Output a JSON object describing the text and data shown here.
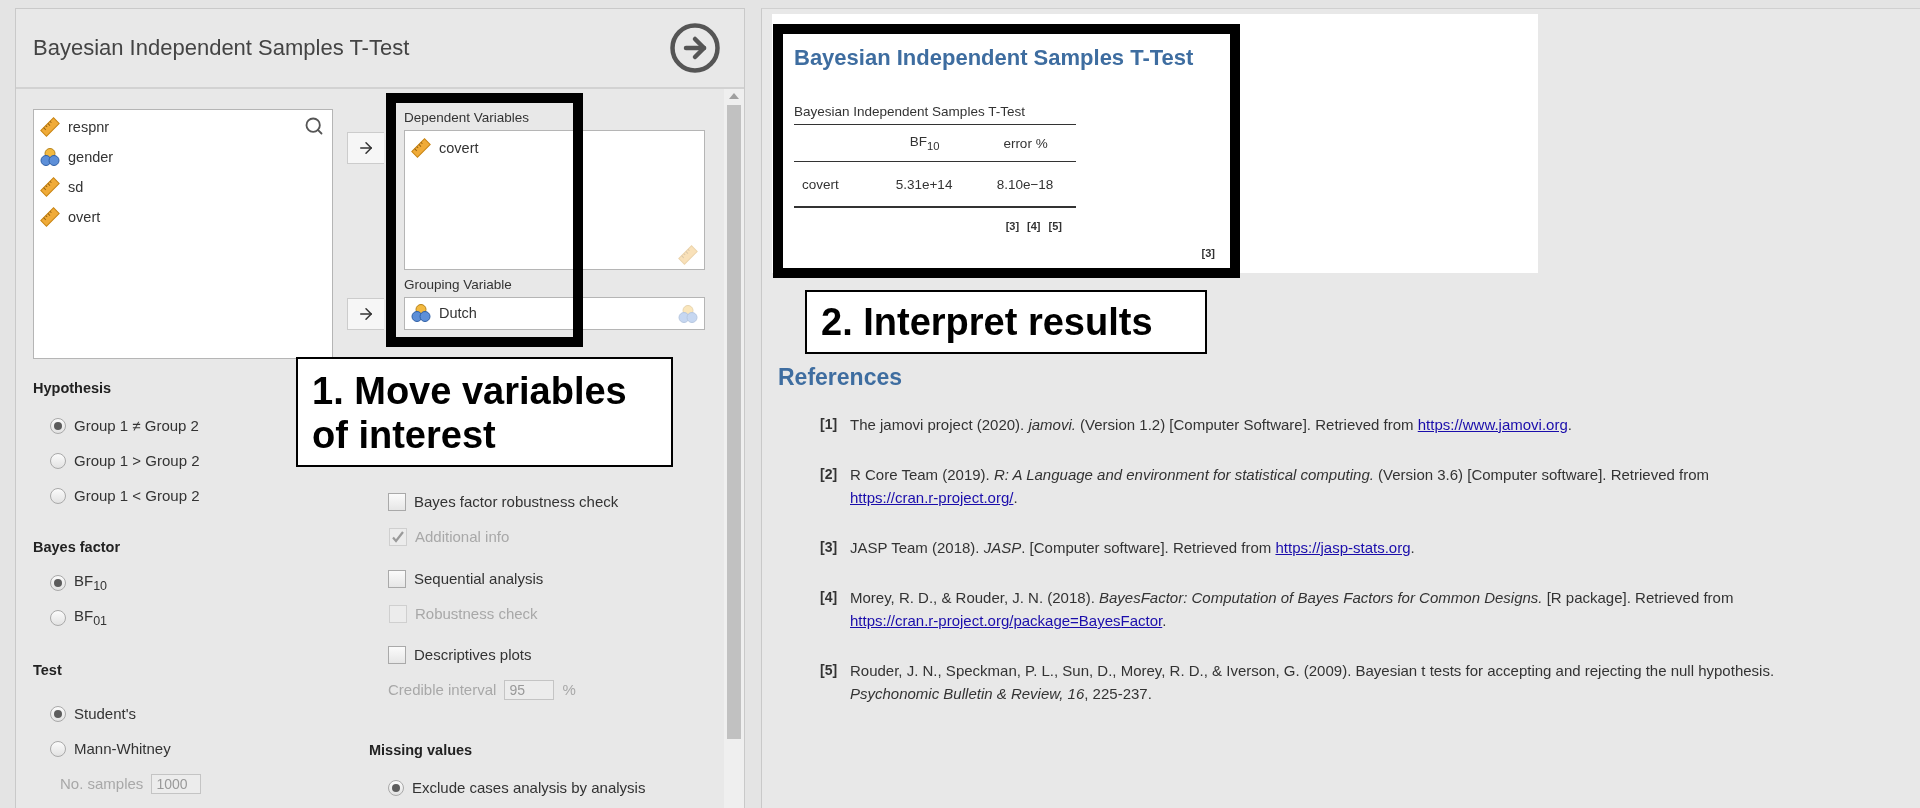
{
  "analysis": {
    "title": "Bayesian Independent Samples T-Test",
    "variables": [
      {
        "name": "respnr",
        "kind": "continuous"
      },
      {
        "name": "gender",
        "kind": "nominal"
      },
      {
        "name": "sd",
        "kind": "continuous"
      },
      {
        "name": "overt",
        "kind": "continuous"
      }
    ],
    "dependent_variables": {
      "label": "Dependent Variables",
      "items": [
        {
          "name": "covert",
          "kind": "continuous"
        }
      ]
    },
    "grouping_variable": {
      "label": "Grouping Variable",
      "items": [
        {
          "name": "Dutch",
          "kind": "nominal"
        }
      ]
    },
    "hypothesis": {
      "label": "Hypothesis",
      "options": [
        {
          "label": "Group 1 ≠ Group 2",
          "selected": true
        },
        {
          "label": "Group 1 > Group 2",
          "selected": false
        },
        {
          "label": "Group 1 < Group 2",
          "selected": false
        }
      ]
    },
    "bayes_factor": {
      "label": "Bayes factor",
      "options": [
        {
          "label": "BF$_{10}$",
          "selected": true
        },
        {
          "label": "BF$_{01}$",
          "selected": false
        }
      ]
    },
    "test": {
      "label": "Test",
      "options": [
        {
          "label": "Student's",
          "selected": true
        },
        {
          "label": "Mann-Whitney",
          "selected": false
        }
      ],
      "samples": {
        "label": "No. samples",
        "value": "1000",
        "disabled": true
      }
    },
    "checks": [
      {
        "label": "Bayes factor robustness check",
        "checked": false,
        "disabled": false,
        "children": [
          {
            "kind": "checkbox",
            "label": "Additional info",
            "checked": true,
            "disabled": true
          }
        ]
      },
      {
        "label": "Sequential analysis",
        "checked": false,
        "disabled": false,
        "children": [
          {
            "kind": "checkbox",
            "label": "Robustness check",
            "checked": false,
            "disabled": true
          }
        ]
      },
      {
        "label": "Descriptives plots",
        "checked": false,
        "disabled": false,
        "children": [
          {
            "kind": "field",
            "label": "Credible interval",
            "value": "95",
            "unit": "%",
            "disabled": true
          }
        ]
      }
    ],
    "missing_values": {
      "label": "Missing values",
      "options": [
        {
          "label": "Exclude cases analysis by analysis",
          "selected": true
        }
      ]
    }
  },
  "results": {
    "title": "Bayesian Independent Samples T-Test",
    "table": {
      "title": "Bayesian Independent Samples T-Test",
      "columns": [
        "",
        "BF$_{10}$",
        "error %"
      ],
      "rows": [
        {
          "cells": [
            "covert",
            "5.31e+14",
            "8.10e−18"
          ]
        }
      ],
      "footnote_refs": [
        "[3]",
        "[4]",
        "[5]"
      ]
    },
    "citation": "[3]"
  },
  "references": {
    "title": "References",
    "items": [
      {
        "number": "[1]",
        "text": "The jamovi project (2020). *jamovi.* (Version 1.2) [Computer Software]. Retrieved from ",
        "link": "https://www.jamovi.org",
        "tail": "."
      },
      {
        "number": "[2]",
        "text": "R Core Team (2019). *R: A Language and environment for statistical computing.* (Version 3.6) [Computer software]. Retrieved from ",
        "link": "https://cran.r-project.org/",
        "tail": "."
      },
      {
        "number": "[3]",
        "text": "JASP Team (2018). *JASP*. [Computer software]. Retrieved from ",
        "link": "https://jasp-stats.org",
        "tail": "."
      },
      {
        "number": "[4]",
        "text": "Morey, R. D., & Rouder, J. N. (2018). *BayesFactor: Computation of Bayes Factors for Common Designs.* [R package]. Retrieved from ",
        "link": "https://cran.r-project.org/package=BayesFactor",
        "tail": "."
      },
      {
        "number": "[5]",
        "text": "Rouder, J. N., Speckman, P. L., Sun, D., Morey, R. D., & Iverson, G. (2009). Bayesian t tests for accepting and rejecting the null hypothesis. *Psychonomic Bulletin & Review, 16*, 225-237."
      }
    ]
  },
  "annotations": [
    {
      "text": "1. Move variables of interest"
    },
    {
      "text": "2. Interpret results"
    }
  ]
}
